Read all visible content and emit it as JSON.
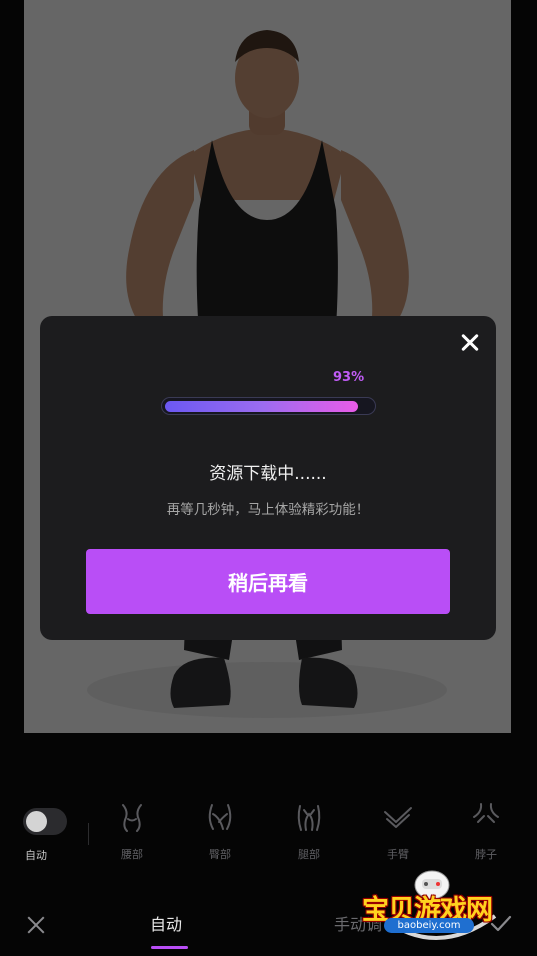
{
  "dialog": {
    "progress_percent_label": "93%",
    "progress_value": 0.93,
    "title": "资源下载中......",
    "subtitle": "再等几秒钟，马上体验精彩功能！",
    "later_button": "稍后再看",
    "close_icon": "close-icon"
  },
  "tools": {
    "auto_toggle_label": "自动",
    "items": [
      {
        "label": "腰部",
        "icon": "waist-icon"
      },
      {
        "label": "臀部",
        "icon": "hip-icon"
      },
      {
        "label": "腿部",
        "icon": "leg-icon"
      },
      {
        "label": "手臂",
        "icon": "arm-icon"
      },
      {
        "label": "脖子",
        "icon": "neck-icon"
      }
    ]
  },
  "bottom_bar": {
    "tab_auto": "自动",
    "tab_manual": "手动调",
    "close_icon": "close-icon",
    "confirm_icon": "check-icon"
  },
  "watermark": {
    "title": "宝贝游戏网",
    "url": "baobeiy.com"
  },
  "colors": {
    "accent": "#b94ef6",
    "progress_start": "#6b58f2",
    "progress_end": "#e95ce8",
    "dialog_bg": "#1c1c1e"
  }
}
